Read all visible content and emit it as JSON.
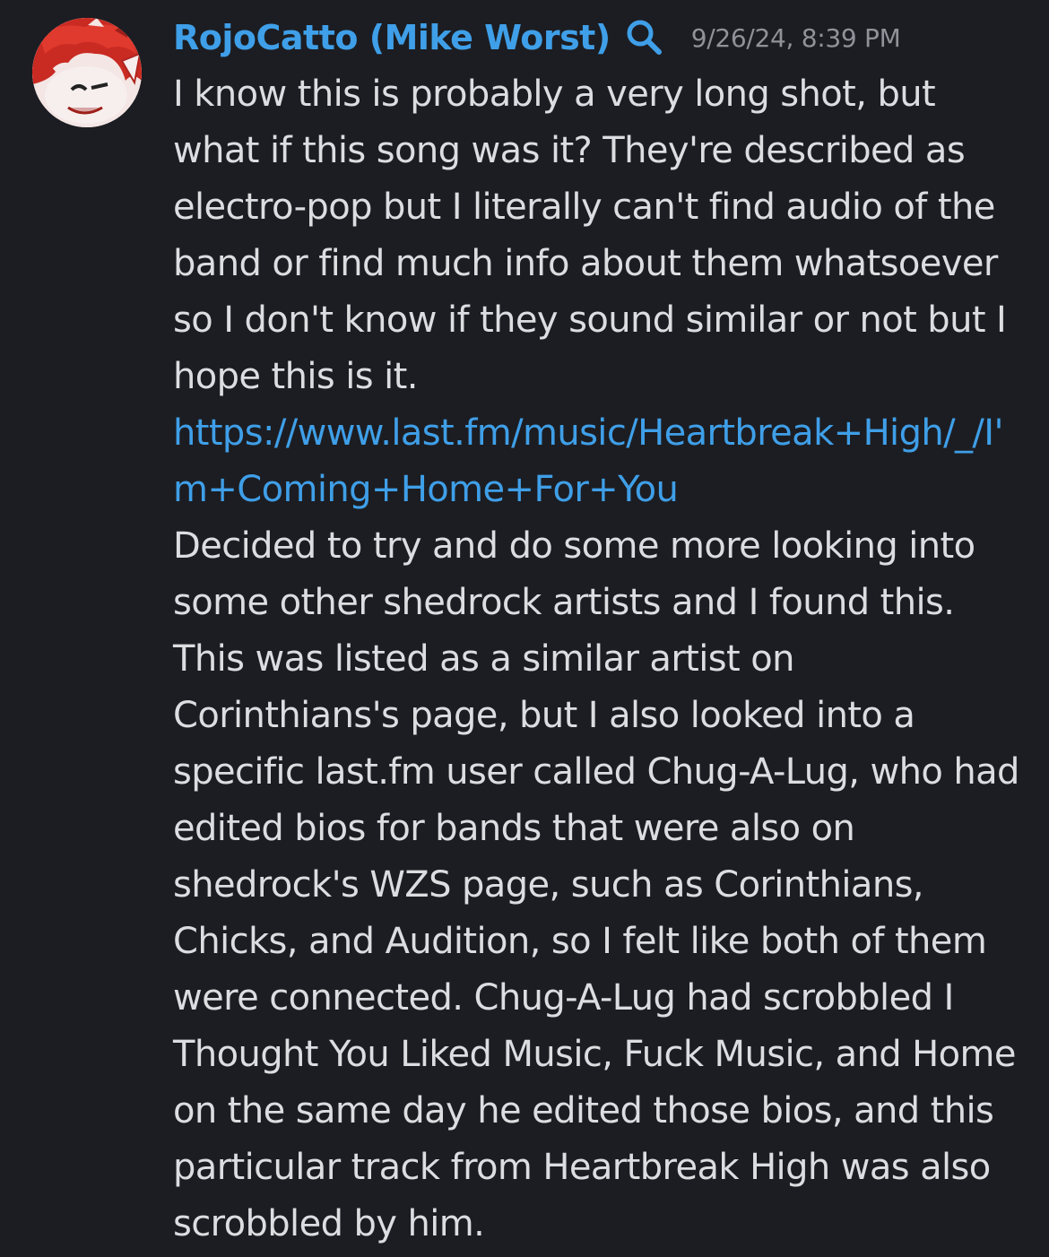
{
  "message": {
    "author": "RojoCatto (Mike Worst)",
    "timestamp": "9/26/24, 8:39 PM",
    "icons": {
      "author_badge": "search-icon",
      "avatar": "red-haired-cartoon-avatar"
    },
    "colors": {
      "background": "#1c1d22",
      "username": "#3f9fe8",
      "link": "#3f9fe8",
      "text": "#dcdde0",
      "timestamp": "#8f9299"
    },
    "paragraph1_text": "I know this is probably a very long shot, but what if this song was it? They're described as electro-pop but I literally can't find audio of the band or find much info about them whatsoever so I don't know if they sound similar or not but I hope this is it. ",
    "paragraph1_link": "https://www.last.fm/music/Heartbreak+High/_/I'm+Coming+Home+For+You",
    "paragraph2_text": "Decided to try and do some more looking into some other shedrock artists and I found this. This was listed as a similar artist on Corinthians's page, but I also looked into a specific last.fm user called Chug-A-Lug, who had edited bios for bands that were also on shedrock's WZS page, such as Corinthians, Chicks, and Audition, so I felt like both of them were connected. Chug-A-Lug had scrobbled I Thought You Liked Music, Fuck Music, and Home on the same day he edited those bios, and this particular track from Heartbreak High was also scrobbled by him."
  }
}
